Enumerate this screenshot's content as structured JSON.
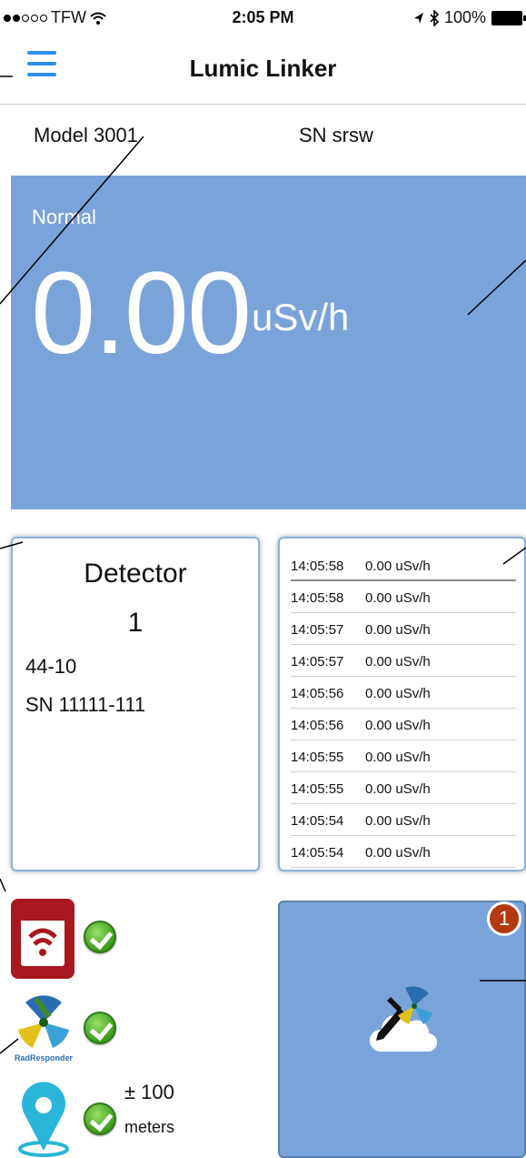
{
  "status_bar": {
    "carrier": "TFW",
    "time": "2:05 PM",
    "battery": "100%"
  },
  "header": {
    "title": "Lumic Linker",
    "menu_icon": "hamburger-menu-icon"
  },
  "device": {
    "model": "Model 3001",
    "serial": "SN  srsw"
  },
  "reading": {
    "status": "Normal",
    "value": "0.00",
    "unit": "uSv/h",
    "color": "#7aa3da"
  },
  "detector": {
    "heading": "Detector",
    "number": "1",
    "model": "44-10",
    "serial": "SN  11111-111"
  },
  "log": [
    {
      "time": "14:05:58",
      "value": "0.00 uSv/h"
    },
    {
      "time": "14:05:58",
      "value": "0.00 uSv/h"
    },
    {
      "time": "14:05:57",
      "value": "0.00 uSv/h"
    },
    {
      "time": "14:05:57",
      "value": "0.00 uSv/h"
    },
    {
      "time": "14:05:56",
      "value": "0.00 uSv/h"
    },
    {
      "time": "14:05:56",
      "value": "0.00 uSv/h"
    },
    {
      "time": "14:05:55",
      "value": "0.00 uSv/h"
    },
    {
      "time": "14:05:55",
      "value": "0.00 uSv/h"
    },
    {
      "time": "14:05:54",
      "value": "0.00 uSv/h"
    },
    {
      "time": "14:05:54",
      "value": "0.00 uSv/h"
    }
  ],
  "connections": {
    "bluetooth_app": {
      "icon": "wifi-device-icon",
      "status": "check-icon"
    },
    "rad_responder": {
      "icon": "rad-responder-icon",
      "label": "RadResponder",
      "status": "check-icon"
    },
    "gps": {
      "icon": "location-pin-icon",
      "status": "check-icon",
      "accuracy": "±  100",
      "unit": "meters"
    }
  },
  "upload": {
    "icon": "cloud-upload-icon",
    "badge": "1"
  }
}
